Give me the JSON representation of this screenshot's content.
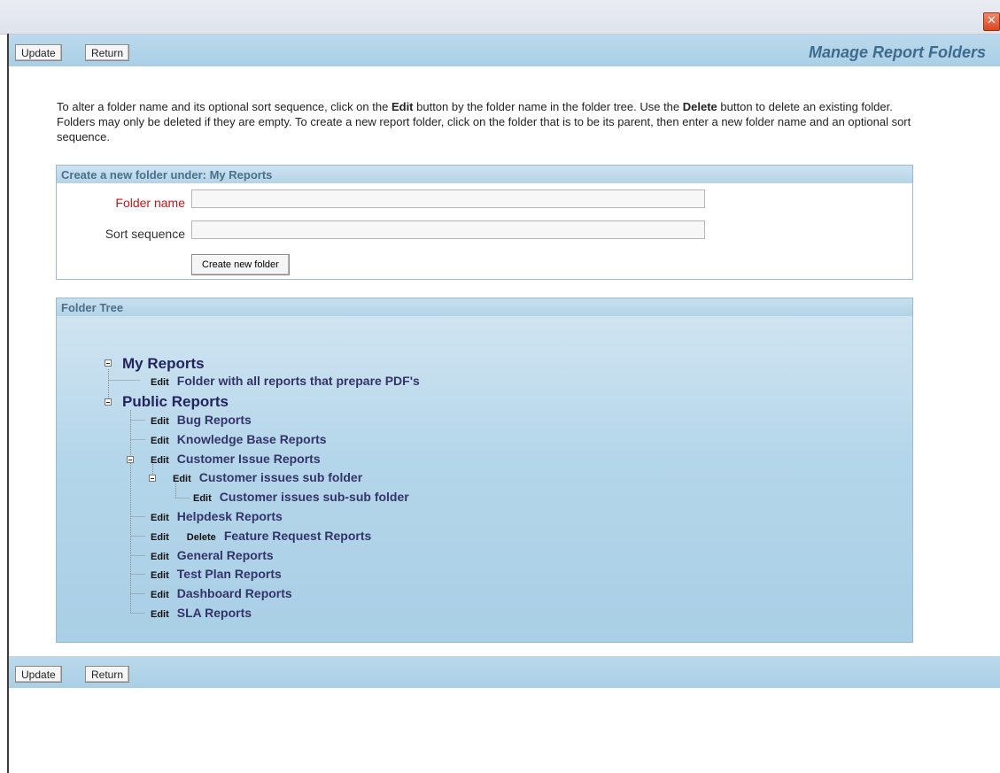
{
  "window": {
    "close_glyph": "✕"
  },
  "toolbar": {
    "update_label": "Update",
    "return_label": "Return"
  },
  "page_title": "Manage Report Folders",
  "intro": {
    "part1": "To alter a folder name and its optional sort sequence, click on the ",
    "edit_word": "Edit",
    "part2": " button by the folder name in the folder tree. Use the ",
    "delete_word": "Delete",
    "part3": " button to delete an existing folder. Folders may only be deleted if they are empty. To create a new report folder, click on the folder that is to be its parent, then enter a new folder name and an optional sort sequence."
  },
  "create_panel": {
    "header": "Create a new folder under: My Reports",
    "folder_name_label": "Folder name",
    "folder_name_value": "",
    "sort_label": "Sort sequence",
    "sort_value": "",
    "create_button": "Create new folder"
  },
  "tree_panel": {
    "header": "Folder Tree",
    "edit_label": "Edit",
    "delete_label": "Delete",
    "nodes": [
      {
        "label": "My Reports"
      },
      {
        "label": "Folder with all reports that prepare PDF's"
      },
      {
        "label": "Public Reports"
      },
      {
        "label": "Bug Reports"
      },
      {
        "label": "Knowledge Base Reports"
      },
      {
        "label": "Customer Issue Reports"
      },
      {
        "label": "Customer issues sub folder"
      },
      {
        "label": "Customer issues sub-sub folder"
      },
      {
        "label": "Helpdesk Reports"
      },
      {
        "label": "Feature Request Reports"
      },
      {
        "label": "General Reports"
      },
      {
        "label": "Test Plan Reports"
      },
      {
        "label": "Dashboard Reports"
      },
      {
        "label": "SLA Reports"
      }
    ]
  },
  "colors": {
    "toolbar": "#a9cfe6",
    "title": "#3f6c8e",
    "required_label": "#c0171c",
    "tree_text": "#2b2b62"
  }
}
